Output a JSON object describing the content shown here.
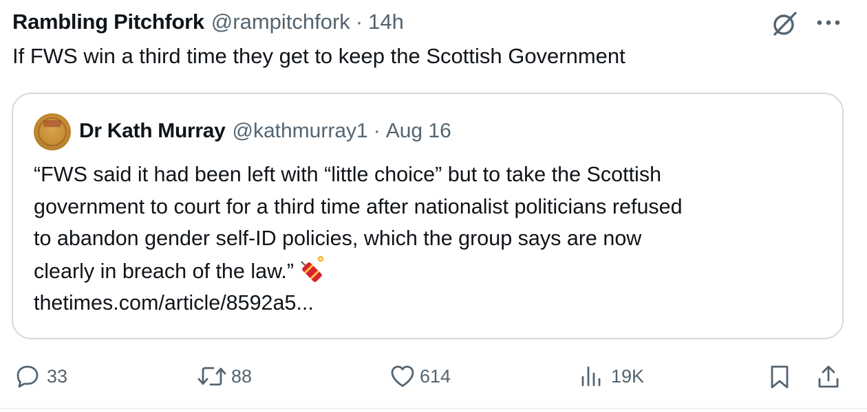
{
  "tweet": {
    "author_name": "Rambling Pitchfork",
    "author_handle": "@rampitchfork",
    "separator": "·",
    "time": "14h",
    "text": "If FWS win a third time they get to keep the Scottish Government"
  },
  "quote": {
    "author_name": "Dr Kath Murray",
    "author_handle": "@kathmurray1",
    "separator": "·",
    "time": "Aug 16",
    "lines": [
      "“FWS said it had been left with “little choice” but to take the Scottish",
      "government to court for a third time after nationalist politicians refused",
      "to abandon gender self-ID policies, which the group says are now",
      "clearly in breach of the law.”"
    ],
    "emoji": "firecracker",
    "link": "thetimes.com/article/8592a5..."
  },
  "actions": {
    "replies": "33",
    "reposts": "88",
    "likes": "614",
    "views": "19K"
  },
  "icons": {
    "grok": "grok-icon",
    "more": "more-icon",
    "reply": "reply-icon",
    "repost": "repost-icon",
    "like": "like-icon",
    "views": "views-icon",
    "bookmark": "bookmark-icon",
    "share": "share-icon"
  },
  "colors": {
    "text": "#0f1419",
    "secondary": "#536471",
    "border": "#cfd9de"
  }
}
